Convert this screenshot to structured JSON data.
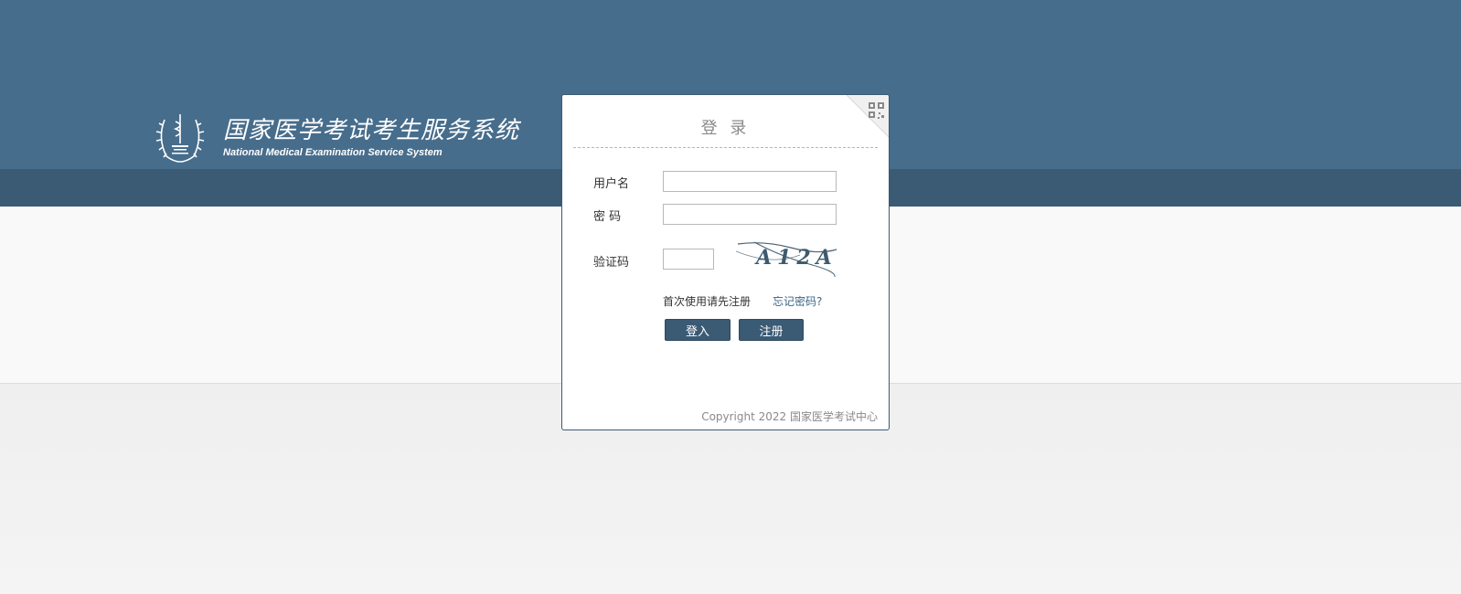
{
  "header": {
    "title_cn": "国家医学考试考生服务系统",
    "title_en": "National Medical Examination Service System"
  },
  "login": {
    "title": "登 录",
    "username_label": "用户名",
    "password_label": "密 码",
    "captcha_label": "验证码",
    "username_value": "",
    "password_value": "",
    "captcha_value": "",
    "captcha_text": "A12A",
    "first_use_hint": "首次使用请先注册",
    "forgot_password": "忘记密码?",
    "login_button": "登入",
    "register_button": "注册",
    "copyright": "Copyright 2022 国家医学考试中心"
  },
  "icons": {
    "emblem": "medical-exam-emblem-icon",
    "qr": "qr-code-icon"
  },
  "colors": {
    "header_blue": "#476d8c",
    "header_dark": "#3b5a74",
    "button": "#3b5a74",
    "link": "#3c6584"
  }
}
